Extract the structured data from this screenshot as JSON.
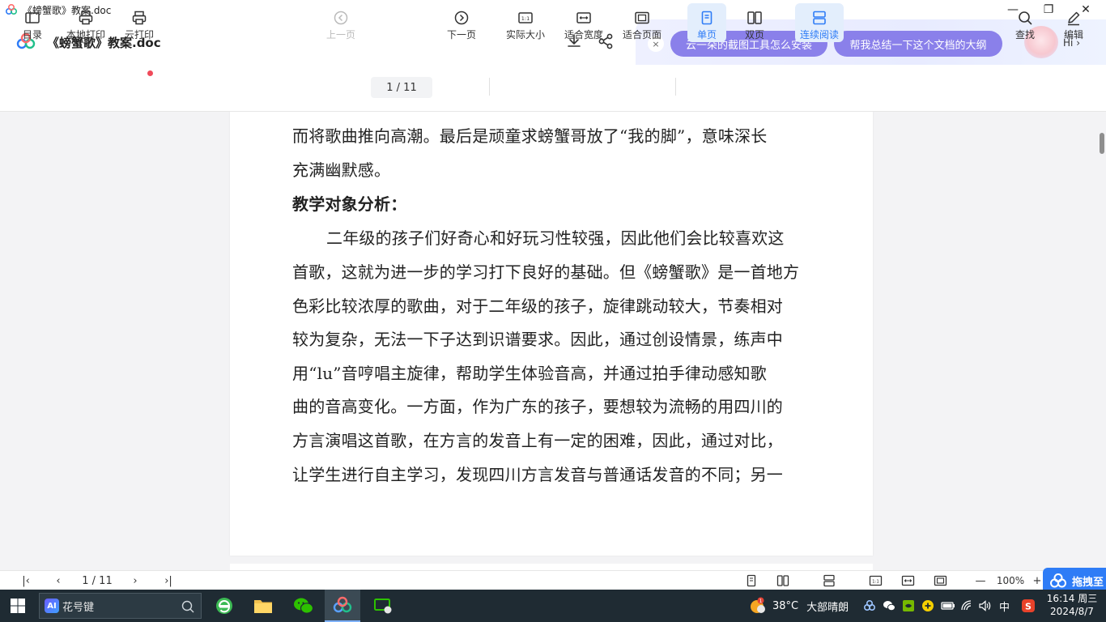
{
  "window": {
    "title": "《螃蟹歌》教案.doc",
    "controls": [
      "—",
      "❐",
      "✕"
    ]
  },
  "header": {
    "doc_title": "《螃蟹歌》教案.doc",
    "icons": [
      "download-icon",
      "share-icon"
    ]
  },
  "ai_panel": {
    "close": "×",
    "chips": [
      "云一朵的截图工具怎么安装",
      "帮我总结一下这个文档的大纲"
    ],
    "greeting": "Hi",
    "arrow": "›"
  },
  "toolbar": {
    "toc": "目录",
    "local_print": "本地打印",
    "cloud_print": "云打印",
    "prev_page": "上一页",
    "page_indicator": "1  / 11",
    "next_page": "下一页",
    "actual_size": "实际大小",
    "fit_width": "适合宽度",
    "fit_page": "适合页面",
    "single_page": "单页",
    "double_page": "双页",
    "continuous": "连续阅读",
    "find": "查找",
    "edit": "编辑"
  },
  "document": {
    "lines": [
      "而将歌曲推向高潮。最后是顽童求螃蟹哥放了“我的脚”，意味深长",
      "充满幽默感。",
      "教学对象分析：",
      "二年级的孩子们好奇心和好玩习性较强，因此他们会比较喜欢这",
      "首歌，这就为进一步的学习打下良好的基础。但《螃蟹歌》是一首地方",
      "色彩比较浓厚的歌曲，对于二年级的孩子，旋律跳动较大，节奏相对",
      "较为复杂，无法一下子达到识谱要求。因此，通过创设情景，练声中",
      "用“lu”音哼唱主旋律，帮助学生体验音高，并通过拍手律动感知歌",
      "曲的音高变化。一方面，作为广东的孩子，要想较为流畅的用四川的",
      "方言演唱这首歌，在方言的发音上有一定的困难，因此，通过对比，",
      "让学生进行自主学习，发现四川方言发音与普通话发音的不同；另一"
    ]
  },
  "statusbar": {
    "first": "|‹",
    "prev": "‹",
    "page": "1  / 11",
    "next": "›",
    "last": "›|",
    "zoom": "100%",
    "zoom_out": "—",
    "zoom_in": "+",
    "promo": "拖拽至"
  },
  "taskbar": {
    "search_badge": "AI",
    "search_text": "花号键",
    "weather_badge": "1",
    "temperature": "38°C",
    "weather": "大部晴朗",
    "ime": "中",
    "time": "16:14 周三",
    "date": "2024/8/7"
  },
  "colors": {
    "accent": "#2e7cf6",
    "chip": "#8a80ea",
    "taskbar": "#1f2b33"
  }
}
